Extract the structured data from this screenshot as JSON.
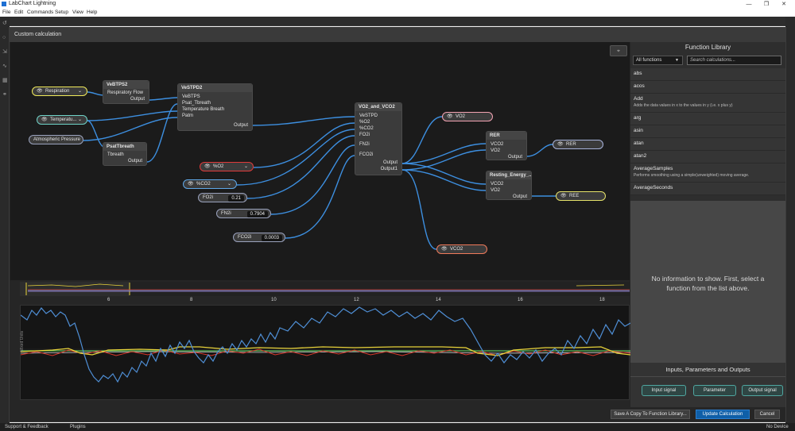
{
  "window": {
    "title": "LabChart Lightning",
    "minimize": "—",
    "maximize": "❐",
    "close": "✕"
  },
  "menu": [
    "File",
    "Edit",
    "Commands",
    "Setup",
    "View",
    "Help"
  ],
  "dialog": {
    "title": "Custom calculation"
  },
  "graph": {
    "inputs": {
      "respiration": "Respiration",
      "temperature": "Temperatu...",
      "atmospheric_pressure": "Atmospheric Pressure",
      "pct_o2": "%O2",
      "pct_co2": "%CO2",
      "fo2i": {
        "label": "FO2i",
        "value": "0.21"
      },
      "fn2i": {
        "label": "FN2i",
        "value": "0.7904"
      },
      "fco2i": {
        "label": "FCO2i",
        "value": "0.0003"
      }
    },
    "nodes": {
      "vebtps2": {
        "title": "VeBTPS2",
        "in1": "Respiratory Flow",
        "out1": "Output"
      },
      "psattbreath": {
        "title": "PsatTbreath",
        "in1": "Tbreath",
        "out1": "Output"
      },
      "vestpd2": {
        "title": "VeSTPD2",
        "in1": "VeBTPS",
        "in2": "Psat_Tbreath",
        "in3": "Temperature Breath",
        "in4": "Patm",
        "out1": "Output"
      },
      "vo2vco2": {
        "title": "VO2_and_VCO2",
        "in1": "VeSTPD",
        "in2": "%O2",
        "in3": "%CO2",
        "in4": "FO2i",
        "in5": "FN2i",
        "in6": "FCO2i",
        "out1": "Output",
        "out2": "Output1"
      },
      "rer": {
        "title": "RER",
        "in1": "VCO2",
        "in2": "VO2",
        "out1": "Output"
      },
      "resting": {
        "title": "Resting_Energy_...",
        "in1": "VCO2",
        "in2": "VO2",
        "out1": "Output"
      }
    },
    "outputs": {
      "vo2": "VO2",
      "rer": "RER",
      "ree": "REE",
      "vco2": "VCO2"
    }
  },
  "time_axis": {
    "ticks": [
      "6",
      "8",
      "10",
      "12",
      "14",
      "16",
      "18"
    ]
  },
  "plot": {
    "y_label": "Mixed Units"
  },
  "library": {
    "title": "Function Library",
    "filter": "All functions",
    "search_placeholder": "Search calculations...",
    "items": [
      {
        "name": "abs",
        "desc": ""
      },
      {
        "name": "acos",
        "desc": ""
      },
      {
        "name": "Add",
        "desc": "Adds the data values in x to the values in y (i.e. x plus y)"
      },
      {
        "name": "arg",
        "desc": ""
      },
      {
        "name": "asin",
        "desc": ""
      },
      {
        "name": "atan",
        "desc": ""
      },
      {
        "name": "atan2",
        "desc": ""
      },
      {
        "name": "AverageSamples",
        "desc": "Performs smoothing using a simple(unweighted) moving average."
      },
      {
        "name": "AverageSeconds",
        "desc": ""
      }
    ]
  },
  "info": {
    "message": "No information to show. First, select a function from the list above."
  },
  "io": {
    "title": "Inputs, Parameters and Outputs",
    "input": "Input signal",
    "param": "Parameter",
    "output": "Output signal"
  },
  "footer": {
    "save_copy": "Save A Copy To Function Library...",
    "update": "Update Calculation",
    "cancel": "Cancel"
  },
  "status": {
    "support": "Support & Feedback",
    "plugins": "Plugins",
    "device": "No Device"
  },
  "colors": {
    "wire": "#3d8fe0",
    "trace_blue": "#4f8fd6",
    "trace_yellow": "#e8d33a",
    "trace_red": "#d8382b",
    "trace_green": "#5ec15e",
    "trace_white": "#d8d8d8"
  }
}
